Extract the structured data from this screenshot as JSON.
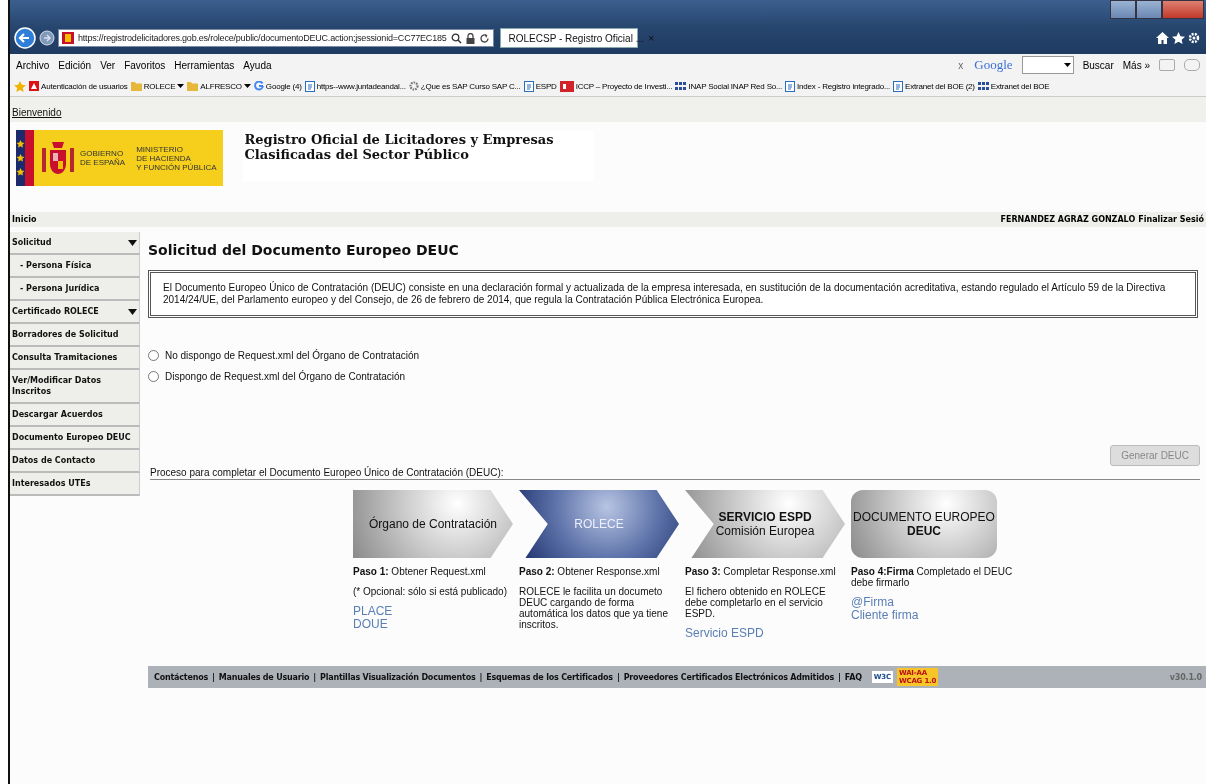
{
  "browser": {
    "address": "https://registrodelicitadores.gob.es/rolece/public/documentoDEUC.action;jsessionid=CC77EC185",
    "tab": {
      "title": "ROLECSP - Registro Oficial ...",
      "close": "×",
      "selected": true
    },
    "menu": [
      "Archivo",
      "Edición",
      "Ver",
      "Favoritos",
      "Herramientas",
      "Ayuda"
    ],
    "search": {
      "clear": "x",
      "engine": "Google",
      "button": "Buscar",
      "more": "Más »"
    },
    "favorites": [
      {
        "label": "Autenticación de usuarios",
        "kind": "triangle",
        "dropdown": false
      },
      {
        "label": "ROLECE",
        "kind": "folder",
        "dropdown": true
      },
      {
        "label": "ALFRESCO",
        "kind": "folder",
        "dropdown": true
      },
      {
        "label": "Google (4)",
        "kind": "letter",
        "dropdown": false
      },
      {
        "label": "https--www.juntadeandal...",
        "kind": "page",
        "dropdown": false
      },
      {
        "label": "¿Que es SAP Curso SAP C...",
        "kind": "gear",
        "dropdown": false
      },
      {
        "label": "ESPD",
        "kind": "page",
        "dropdown": false
      },
      {
        "label": "ICCP – Proyecto de Investi...",
        "kind": "square",
        "dropdown": false
      },
      {
        "label": "INAP Social  INAP Red So...",
        "kind": "grid",
        "dropdown": false
      },
      {
        "label": "Index - Registro integrado...",
        "kind": "page",
        "dropdown": false
      },
      {
        "label": "Extranet del BOE (2)",
        "kind": "page",
        "dropdown": false
      },
      {
        "label": "Extranet del BOE",
        "kind": "grid",
        "dropdown": false
      }
    ]
  },
  "page": {
    "welcome": "Bienvenido",
    "logo": {
      "government": [
        "GOBIERNO",
        "DE ESPAÑA"
      ],
      "ministry": [
        "MINISTERIO",
        "DE HACIENDA",
        "Y FUNCIÓN PÚBLICA"
      ]
    },
    "site_title": [
      "Registro Oficial de Licitadores y Empresas",
      "Clasificadas del Sector Público"
    ],
    "breadcrumb": "Inicio",
    "user": "FERNANDEZ AGRAZ GONZALO",
    "logout": "Finalizar Sesió",
    "sidebar": [
      {
        "label": "Solicitud",
        "expandable": true,
        "children": [
          {
            "label": "- Persona Física"
          },
          {
            "label": "- Persona Jurídica"
          }
        ]
      },
      {
        "label": "Certificado ROLECE",
        "expandable": true
      },
      {
        "label": "Borradores de Solicitud",
        "expandable": false
      },
      {
        "label": "Consulta Tramitaciones",
        "expandable": false
      },
      {
        "label": "Ver/Modificar Datos Inscritos",
        "expandable": false
      },
      {
        "label": "Descargar Acuerdos",
        "expandable": false
      },
      {
        "label": "Documento Europeo DEUC",
        "expandable": false
      },
      {
        "label": "Datos de Contacto",
        "expandable": false
      },
      {
        "label": "Interesados UTEs",
        "expandable": false
      }
    ],
    "heading": "Solicitud del Documento Europeo DEUC",
    "intro": "El Documento Europeo Único de Contratación (DEUC) consiste en una declaración formal y actualizada de la empresa interesada, en sustitución de la documentación acreditativa, estando regulado el Artículo 59 de la Directiva 2014/24/UE, del Parlamento europeo y del Consejo, de 26 de febrero de 2014, que regula la Contratación Pública Electrónica Europea.",
    "options": [
      {
        "label": "No dispongo de Request.xml del Órgano de Contratación",
        "selected": false
      },
      {
        "label": "Dispongo de Request.xml del Órgano de Contratación",
        "selected": false
      }
    ],
    "generate_button": {
      "label": "Generar DEUC",
      "disabled": true
    },
    "process_title": "Proceso para completar el Documento Europeo Único de Contratación (DEUC):",
    "steps": [
      {
        "kind": "start",
        "title": [
          "Órgano de Contratación"
        ],
        "caption": "**Paso 1:** Obtener Request.xml",
        "notes": [
          "(* Opcional: sólo si está publicado)"
        ],
        "links": [
          "PLACE",
          "DOUE"
        ]
      },
      {
        "kind": "current",
        "title": [
          "ROLECE"
        ],
        "caption": "**Paso 2:** Obtener Response.xml",
        "notes": [
          "ROLECE le facilita un documeto DEUC cargando de forma automática los datos que ya tiene inscritos."
        ]
      },
      {
        "kind": "middle",
        "title": [
          "**SERVICIO ESPD**",
          "Comisión Europea"
        ],
        "caption": "**Paso 3:** Completar Response.xml",
        "notes": [
          "El fichero obtenido en ROLECE debe completarlo en el servicio ESPD."
        ],
        "links": [
          "Servicio ESPD"
        ]
      },
      {
        "kind": "end",
        "title": [
          "DOCUMENTO EUROPEO",
          "**DEUC**"
        ],
        "caption": "**Paso 4:Firma** Completado el DEUC debe firmarlo",
        "links": [
          "@Firma",
          "Cliente firma"
        ]
      }
    ],
    "footer": {
      "links": [
        "Contáctenos",
        "Manuales de Usuario",
        "Plantillas Visualización Documentos",
        "Esquemas de los Certificados",
        "Proveedores Certificados Electrónicos Admitidos",
        "FAQ"
      ],
      "separator": "|",
      "badge_w3c": "W3C",
      "badge_wai": [
        "WAI-AA",
        "WCAG 1.0"
      ],
      "version": "v30.1.0"
    }
  }
}
